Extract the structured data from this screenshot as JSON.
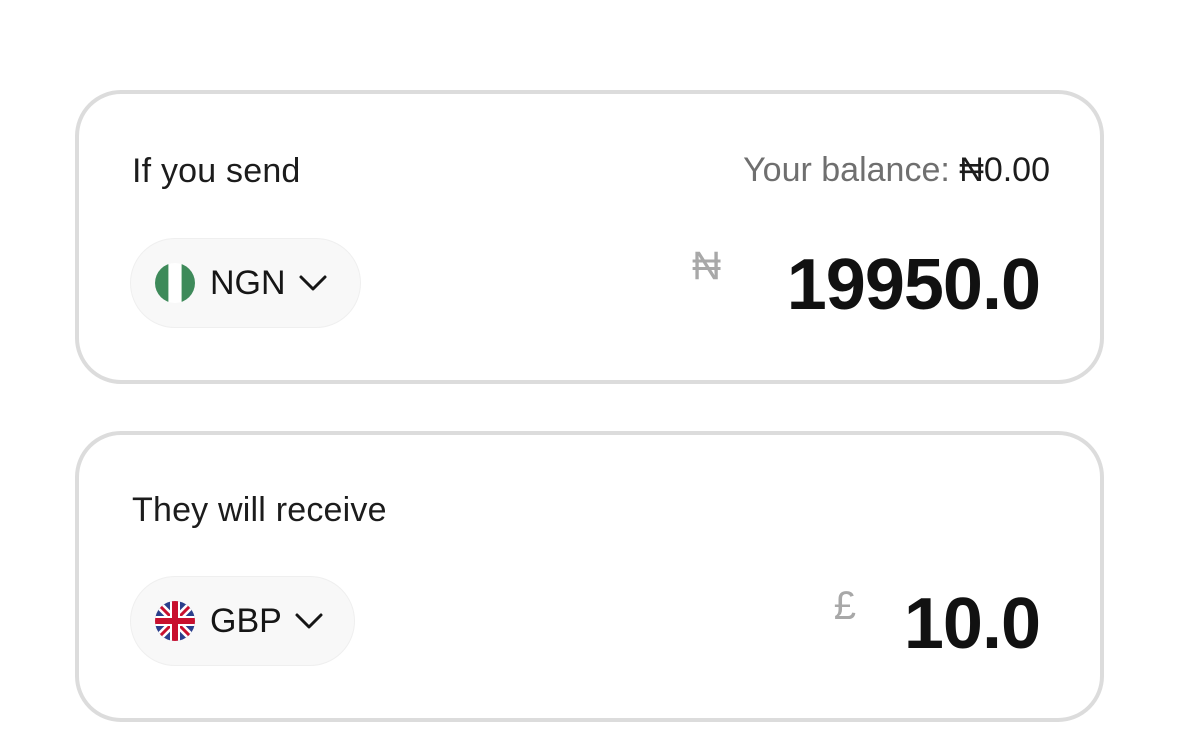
{
  "send": {
    "label": "If you send",
    "balance_label": "Your balance:",
    "balance_value": "₦0.00",
    "currency_code": "NGN",
    "currency_flag_icon": "nigeria-flag-icon",
    "currency_symbol": "₦",
    "amount": "19950.0"
  },
  "receive": {
    "label": "They will receive",
    "currency_code": "GBP",
    "currency_flag_icon": "uk-flag-icon",
    "currency_symbol": "£",
    "amount": "10.0"
  },
  "colors": {
    "card_border": "#dcdcdc",
    "nigeria_green": "#3e8a5a",
    "uk_blue": "#2b3f8c",
    "uk_red": "#c8102e",
    "muted_text": "#6f6f6f",
    "symbol_gray": "#a8a8a8"
  }
}
